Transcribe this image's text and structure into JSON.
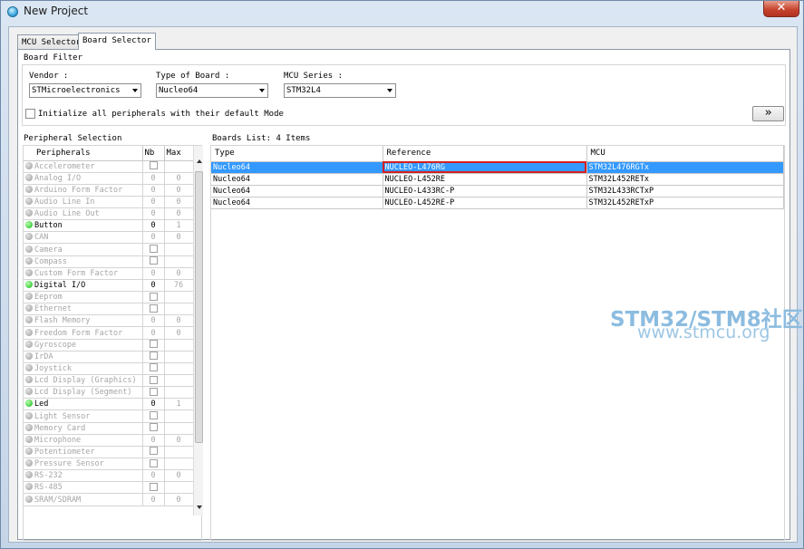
{
  "window": {
    "title": "New Project",
    "close_label": "✕"
  },
  "tabs": [
    {
      "label": "MCU Selector",
      "active": false
    },
    {
      "label": "Board Selector",
      "active": true
    }
  ],
  "board_filter": {
    "title": "Board Filter",
    "vendor": {
      "label": "Vendor :",
      "value": "STMicroelectronics"
    },
    "type_of_board": {
      "label": "Type of Board :",
      "value": "Nucleo64"
    },
    "mcu_series": {
      "label": "MCU Series :",
      "value": "STM32L4"
    },
    "init_peripherals": {
      "label": "Initialize all peripherals with their default Mode",
      "checked": false
    },
    "expand_button": "»"
  },
  "peripheral_selection": {
    "title": "Peripheral Selection",
    "columns": [
      "Peripherals",
      "Nb",
      "Max"
    ],
    "rows": [
      {
        "name": "Accelerometer",
        "state": "disabled",
        "nb": "",
        "max": "",
        "checkbox": true
      },
      {
        "name": "Analog I/O",
        "state": "disabled",
        "nb": "0",
        "max": "0",
        "checkbox": false
      },
      {
        "name": "Arduino Form Factor",
        "state": "disabled",
        "nb": "0",
        "max": "0",
        "checkbox": false
      },
      {
        "name": "Audio Line In",
        "state": "disabled",
        "nb": "0",
        "max": "0",
        "checkbox": false
      },
      {
        "name": "Audio Line Out",
        "state": "disabled",
        "nb": "0",
        "max": "0",
        "checkbox": false
      },
      {
        "name": "Button",
        "state": "active",
        "nb": "0",
        "max": "1",
        "checkbox": false
      },
      {
        "name": "CAN",
        "state": "disabled",
        "nb": "0",
        "max": "0",
        "checkbox": false
      },
      {
        "name": "Camera",
        "state": "disabled",
        "nb": "",
        "max": "",
        "checkbox": true
      },
      {
        "name": "Compass",
        "state": "disabled",
        "nb": "",
        "max": "",
        "checkbox": true
      },
      {
        "name": "Custom Form Factor",
        "state": "disabled",
        "nb": "0",
        "max": "0",
        "checkbox": false
      },
      {
        "name": "Digital I/O",
        "state": "active",
        "nb": "0",
        "max": "76",
        "checkbox": false
      },
      {
        "name": "Eeprom",
        "state": "disabled",
        "nb": "",
        "max": "",
        "checkbox": true
      },
      {
        "name": "Ethernet",
        "state": "disabled",
        "nb": "",
        "max": "",
        "checkbox": true
      },
      {
        "name": "Flash Memory",
        "state": "disabled",
        "nb": "0",
        "max": "0",
        "checkbox": false
      },
      {
        "name": "Freedom Form Factor",
        "state": "disabled",
        "nb": "0",
        "max": "0",
        "checkbox": false
      },
      {
        "name": "Gyroscope",
        "state": "disabled",
        "nb": "",
        "max": "",
        "checkbox": true
      },
      {
        "name": "IrDA",
        "state": "disabled",
        "nb": "",
        "max": "",
        "checkbox": true
      },
      {
        "name": "Joystick",
        "state": "disabled",
        "nb": "",
        "max": "",
        "checkbox": true
      },
      {
        "name": "Lcd Display (Graphics)",
        "state": "disabled",
        "nb": "",
        "max": "",
        "checkbox": true
      },
      {
        "name": "Lcd Display (Segment)",
        "state": "disabled",
        "nb": "",
        "max": "",
        "checkbox": true
      },
      {
        "name": "Led",
        "state": "active",
        "nb": "0",
        "max": "1",
        "checkbox": false
      },
      {
        "name": "Light Sensor",
        "state": "disabled",
        "nb": "",
        "max": "",
        "checkbox": true
      },
      {
        "name": "Memory Card",
        "state": "disabled",
        "nb": "",
        "max": "",
        "checkbox": true
      },
      {
        "name": "Microphone",
        "state": "disabled",
        "nb": "0",
        "max": "0",
        "checkbox": false
      },
      {
        "name": "Potentiometer",
        "state": "disabled",
        "nb": "",
        "max": "",
        "checkbox": true
      },
      {
        "name": "Pressure Sensor",
        "state": "disabled",
        "nb": "",
        "max": "",
        "checkbox": true
      },
      {
        "name": "RS-232",
        "state": "disabled",
        "nb": "0",
        "max": "0",
        "checkbox": false
      },
      {
        "name": "RS-485",
        "state": "disabled",
        "nb": "",
        "max": "",
        "checkbox": true
      },
      {
        "name": "SRAM/SDRAM",
        "state": "disabled",
        "nb": "0",
        "max": "0",
        "checkbox": false
      }
    ]
  },
  "boards_list": {
    "title": "Boards List: 4 Items",
    "columns": [
      "Type",
      "Reference",
      "MCU"
    ],
    "rows": [
      {
        "type": "Nucleo64",
        "reference": "NUCLEO-L476RG",
        "mcu": "STM32L476RGTx",
        "selected": true
      },
      {
        "type": "Nucleo64",
        "reference": "NUCLEO-L452RE",
        "mcu": "STM32L452RETx",
        "selected": false
      },
      {
        "type": "Nucleo64",
        "reference": "NUCLEO-L433RC-P",
        "mcu": "STM32L433RCTxP",
        "selected": false
      },
      {
        "type": "Nucleo64",
        "reference": "NUCLEO-L452RE-P",
        "mcu": "STM32L452RETxP",
        "selected": false
      }
    ],
    "highlight_color": "#d42020",
    "selection_color": "#3399ff"
  },
  "watermark": {
    "line1": "STM32/STM8社区",
    "line2": "www.stmcu.org"
  }
}
